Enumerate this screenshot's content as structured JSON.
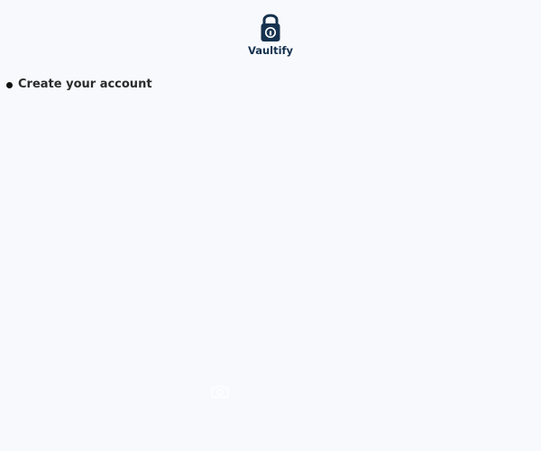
{
  "brand": {
    "name": "Vaultify",
    "logo_icon": "padlock-icon",
    "primary_color": "#16324f"
  },
  "onboarding": {
    "step_title": "Create your account",
    "step_bullet_icon": "bullet-icon"
  },
  "controls": {
    "camera_icon": "camera-icon"
  }
}
